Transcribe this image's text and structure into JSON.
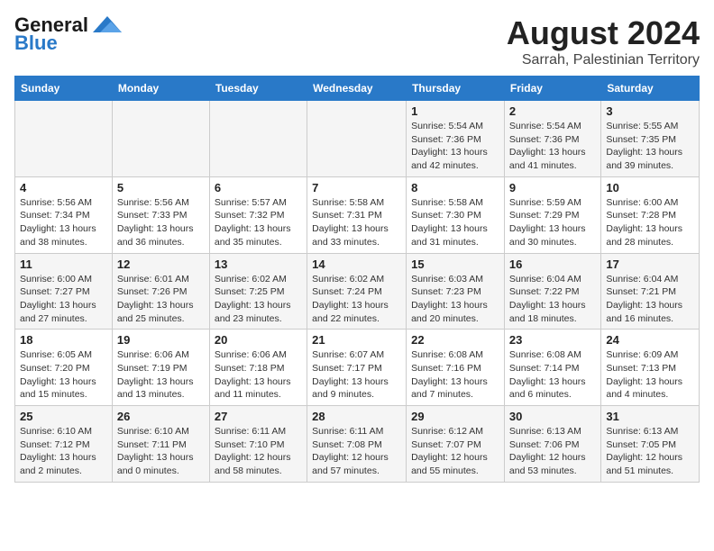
{
  "header": {
    "logo_general": "General",
    "logo_blue": "Blue",
    "title": "August 2024",
    "subtitle": "Sarrah, Palestinian Territory"
  },
  "weekdays": [
    "Sunday",
    "Monday",
    "Tuesday",
    "Wednesday",
    "Thursday",
    "Friday",
    "Saturday"
  ],
  "weeks": [
    [
      {
        "day": "",
        "info": ""
      },
      {
        "day": "",
        "info": ""
      },
      {
        "day": "",
        "info": ""
      },
      {
        "day": "",
        "info": ""
      },
      {
        "day": "1",
        "info": "Sunrise: 5:54 AM\nSunset: 7:36 PM\nDaylight: 13 hours\nand 42 minutes."
      },
      {
        "day": "2",
        "info": "Sunrise: 5:54 AM\nSunset: 7:36 PM\nDaylight: 13 hours\nand 41 minutes."
      },
      {
        "day": "3",
        "info": "Sunrise: 5:55 AM\nSunset: 7:35 PM\nDaylight: 13 hours\nand 39 minutes."
      }
    ],
    [
      {
        "day": "4",
        "info": "Sunrise: 5:56 AM\nSunset: 7:34 PM\nDaylight: 13 hours\nand 38 minutes."
      },
      {
        "day": "5",
        "info": "Sunrise: 5:56 AM\nSunset: 7:33 PM\nDaylight: 13 hours\nand 36 minutes."
      },
      {
        "day": "6",
        "info": "Sunrise: 5:57 AM\nSunset: 7:32 PM\nDaylight: 13 hours\nand 35 minutes."
      },
      {
        "day": "7",
        "info": "Sunrise: 5:58 AM\nSunset: 7:31 PM\nDaylight: 13 hours\nand 33 minutes."
      },
      {
        "day": "8",
        "info": "Sunrise: 5:58 AM\nSunset: 7:30 PM\nDaylight: 13 hours\nand 31 minutes."
      },
      {
        "day": "9",
        "info": "Sunrise: 5:59 AM\nSunset: 7:29 PM\nDaylight: 13 hours\nand 30 minutes."
      },
      {
        "day": "10",
        "info": "Sunrise: 6:00 AM\nSunset: 7:28 PM\nDaylight: 13 hours\nand 28 minutes."
      }
    ],
    [
      {
        "day": "11",
        "info": "Sunrise: 6:00 AM\nSunset: 7:27 PM\nDaylight: 13 hours\nand 27 minutes."
      },
      {
        "day": "12",
        "info": "Sunrise: 6:01 AM\nSunset: 7:26 PM\nDaylight: 13 hours\nand 25 minutes."
      },
      {
        "day": "13",
        "info": "Sunrise: 6:02 AM\nSunset: 7:25 PM\nDaylight: 13 hours\nand 23 minutes."
      },
      {
        "day": "14",
        "info": "Sunrise: 6:02 AM\nSunset: 7:24 PM\nDaylight: 13 hours\nand 22 minutes."
      },
      {
        "day": "15",
        "info": "Sunrise: 6:03 AM\nSunset: 7:23 PM\nDaylight: 13 hours\nand 20 minutes."
      },
      {
        "day": "16",
        "info": "Sunrise: 6:04 AM\nSunset: 7:22 PM\nDaylight: 13 hours\nand 18 minutes."
      },
      {
        "day": "17",
        "info": "Sunrise: 6:04 AM\nSunset: 7:21 PM\nDaylight: 13 hours\nand 16 minutes."
      }
    ],
    [
      {
        "day": "18",
        "info": "Sunrise: 6:05 AM\nSunset: 7:20 PM\nDaylight: 13 hours\nand 15 minutes."
      },
      {
        "day": "19",
        "info": "Sunrise: 6:06 AM\nSunset: 7:19 PM\nDaylight: 13 hours\nand 13 minutes."
      },
      {
        "day": "20",
        "info": "Sunrise: 6:06 AM\nSunset: 7:18 PM\nDaylight: 13 hours\nand 11 minutes."
      },
      {
        "day": "21",
        "info": "Sunrise: 6:07 AM\nSunset: 7:17 PM\nDaylight: 13 hours\nand 9 minutes."
      },
      {
        "day": "22",
        "info": "Sunrise: 6:08 AM\nSunset: 7:16 PM\nDaylight: 13 hours\nand 7 minutes."
      },
      {
        "day": "23",
        "info": "Sunrise: 6:08 AM\nSunset: 7:14 PM\nDaylight: 13 hours\nand 6 minutes."
      },
      {
        "day": "24",
        "info": "Sunrise: 6:09 AM\nSunset: 7:13 PM\nDaylight: 13 hours\nand 4 minutes."
      }
    ],
    [
      {
        "day": "25",
        "info": "Sunrise: 6:10 AM\nSunset: 7:12 PM\nDaylight: 13 hours\nand 2 minutes."
      },
      {
        "day": "26",
        "info": "Sunrise: 6:10 AM\nSunset: 7:11 PM\nDaylight: 13 hours\nand 0 minutes."
      },
      {
        "day": "27",
        "info": "Sunrise: 6:11 AM\nSunset: 7:10 PM\nDaylight: 12 hours\nand 58 minutes."
      },
      {
        "day": "28",
        "info": "Sunrise: 6:11 AM\nSunset: 7:08 PM\nDaylight: 12 hours\nand 57 minutes."
      },
      {
        "day": "29",
        "info": "Sunrise: 6:12 AM\nSunset: 7:07 PM\nDaylight: 12 hours\nand 55 minutes."
      },
      {
        "day": "30",
        "info": "Sunrise: 6:13 AM\nSunset: 7:06 PM\nDaylight: 12 hours\nand 53 minutes."
      },
      {
        "day": "31",
        "info": "Sunrise: 6:13 AM\nSunset: 7:05 PM\nDaylight: 12 hours\nand 51 minutes."
      }
    ]
  ]
}
